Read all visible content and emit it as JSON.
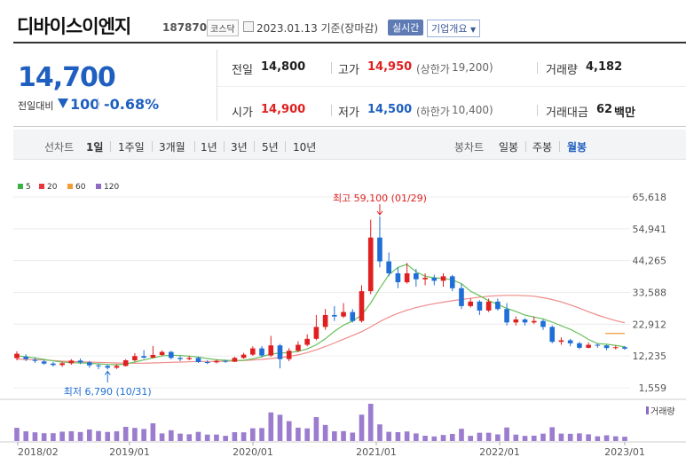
{
  "header": {
    "title": "디바이스이엔지",
    "code": "187870",
    "market_tag": "코스닥",
    "date": "2023.01.13 기준(장마감)",
    "realtime_label": "실시간",
    "company_info_label": "기업개요"
  },
  "quote": {
    "price": "14,700",
    "change_label": "전일대비",
    "change_value": "100",
    "change_pct": "-0.68%",
    "prev_label": "전일",
    "prev_value": "14,800",
    "high_label": "고가",
    "high_value": "14,950",
    "upper_limit_label": "(상한가",
    "upper_limit_value": "19,200)",
    "volume_label": "거래량",
    "volume_value": "4,182",
    "open_label": "시가",
    "open_value": "14,900",
    "low_label": "저가",
    "low_value": "14,500",
    "lower_limit_label": "(하한가",
    "lower_limit_value": "10,400)",
    "amount_label": "거래대금",
    "amount_value": "62",
    "amount_unit": "백만"
  },
  "toolbar": {
    "line_label": "선차트",
    "periods": [
      "1일",
      "1주일",
      "3개월",
      "1년",
      "3년",
      "5년",
      "10년"
    ],
    "candle_label": "봉차트",
    "candle_periods": [
      "일봉",
      "주봉",
      "월봉"
    ],
    "active_candle": "월봉"
  },
  "legend": [
    {
      "name": "5",
      "color": "#3cb043"
    },
    {
      "name": "20",
      "color": "#e8383d"
    },
    {
      "name": "60",
      "color": "#f39c34"
    },
    {
      "name": "120",
      "color": "#8e6cc4"
    }
  ],
  "chart_data": {
    "type": "candlestick",
    "y_ticks": [
      "65,618",
      "54,941",
      "44,265",
      "33,588",
      "22,912",
      "12,235",
      "1,559"
    ],
    "ylim": [
      1559,
      65618
    ],
    "x_ticks": [
      "2018/02",
      "2019/01",
      "2020/01",
      "2021/01",
      "2022/01",
      "2023/01"
    ],
    "high_annotation": "최고 59,100 (01/29)",
    "low_annotation": "최저 6,790 (10/31)",
    "volume_label": "거래량",
    "candles": [
      {
        "o": 11500,
        "c": 13000,
        "h": 13800,
        "l": 10800
      },
      {
        "o": 12000,
        "c": 11200,
        "h": 12800,
        "l": 10500
      },
      {
        "o": 11000,
        "c": 10600,
        "h": 11800,
        "l": 9900
      },
      {
        "o": 10400,
        "c": 9700,
        "h": 10900,
        "l": 9300
      },
      {
        "o": 9700,
        "c": 9200,
        "h": 10200,
        "l": 8700
      },
      {
        "o": 9200,
        "c": 9800,
        "h": 10300,
        "l": 8600
      },
      {
        "o": 9800,
        "c": 10700,
        "h": 11200,
        "l": 9300
      },
      {
        "o": 10700,
        "c": 10100,
        "h": 11400,
        "l": 9500
      },
      {
        "o": 10100,
        "c": 9100,
        "h": 10600,
        "l": 8300
      },
      {
        "o": 9100,
        "c": 8900,
        "h": 9600,
        "l": 7800
      },
      {
        "o": 8900,
        "c": 8300,
        "h": 9300,
        "l": 7700
      },
      {
        "o": 8300,
        "c": 8900,
        "h": 9500,
        "l": 7900
      },
      {
        "o": 8900,
        "c": 10800,
        "h": 11200,
        "l": 8700
      },
      {
        "o": 10800,
        "c": 12200,
        "h": 13200,
        "l": 10400
      },
      {
        "o": 12200,
        "c": 11700,
        "h": 14200,
        "l": 11300
      },
      {
        "o": 11700,
        "c": 12600,
        "h": 15600,
        "l": 11500
      },
      {
        "o": 12600,
        "c": 13600,
        "h": 14100,
        "l": 12200
      },
      {
        "o": 13600,
        "c": 11600,
        "h": 14000,
        "l": 11100
      },
      {
        "o": 11600,
        "c": 11200,
        "h": 12200,
        "l": 10500
      },
      {
        "o": 11200,
        "c": 11600,
        "h": 12300,
        "l": 10800
      },
      {
        "o": 11600,
        "c": 10200,
        "h": 12000,
        "l": 9900
      },
      {
        "o": 10200,
        "c": 10100,
        "h": 10800,
        "l": 9500
      },
      {
        "o": 10100,
        "c": 10600,
        "h": 11100,
        "l": 9800
      },
      {
        "o": 10600,
        "c": 10300,
        "h": 11000,
        "l": 9900
      },
      {
        "o": 10300,
        "c": 11600,
        "h": 12000,
        "l": 10200
      },
      {
        "o": 11600,
        "c": 12700,
        "h": 13300,
        "l": 11300
      },
      {
        "o": 12700,
        "c": 14800,
        "h": 15500,
        "l": 12300
      },
      {
        "o": 14800,
        "c": 12400,
        "h": 15600,
        "l": 11800
      },
      {
        "o": 12400,
        "c": 15800,
        "h": 19000,
        "l": 12000
      },
      {
        "o": 15800,
        "c": 11200,
        "h": 16300,
        "l": 8100
      },
      {
        "o": 11200,
        "c": 14000,
        "h": 14900,
        "l": 10500
      },
      {
        "o": 14000,
        "c": 16000,
        "h": 17200,
        "l": 13500
      },
      {
        "o": 16000,
        "c": 18000,
        "h": 19500,
        "l": 15500
      },
      {
        "o": 18000,
        "c": 22000,
        "h": 26000,
        "l": 17500
      },
      {
        "o": 22000,
        "c": 26000,
        "h": 28000,
        "l": 21000
      },
      {
        "o": 26000,
        "c": 25500,
        "h": 29000,
        "l": 24000
      },
      {
        "o": 25500,
        "c": 27000,
        "h": 30000,
        "l": 25000
      },
      {
        "o": 27000,
        "c": 24000,
        "h": 28000,
        "l": 23500
      },
      {
        "o": 24000,
        "c": 34000,
        "h": 36000,
        "l": 23500
      },
      {
        "o": 34000,
        "c": 52000,
        "h": 58000,
        "l": 33000
      },
      {
        "o": 52000,
        "c": 44000,
        "h": 59100,
        "l": 42000
      },
      {
        "o": 44000,
        "c": 40000,
        "h": 47000,
        "l": 39000
      },
      {
        "o": 40000,
        "c": 37000,
        "h": 42000,
        "l": 35000
      },
      {
        "o": 37000,
        "c": 40000,
        "h": 43500,
        "l": 36500
      },
      {
        "o": 40000,
        "c": 38000,
        "h": 41500,
        "l": 35500
      },
      {
        "o": 38000,
        "c": 38500,
        "h": 40000,
        "l": 36000
      },
      {
        "o": 38500,
        "c": 37500,
        "h": 39500,
        "l": 36000
      },
      {
        "o": 37500,
        "c": 39000,
        "h": 40000,
        "l": 35500
      },
      {
        "o": 39000,
        "c": 35000,
        "h": 39500,
        "l": 34000
      },
      {
        "o": 35000,
        "c": 29000,
        "h": 36500,
        "l": 28000
      },
      {
        "o": 29000,
        "c": 30500,
        "h": 31500,
        "l": 28500
      },
      {
        "o": 30500,
        "c": 27500,
        "h": 31000,
        "l": 26000
      },
      {
        "o": 27500,
        "c": 30500,
        "h": 31500,
        "l": 27000
      },
      {
        "o": 30500,
        "c": 28000,
        "h": 31500,
        "l": 27500
      },
      {
        "o": 28000,
        "c": 23500,
        "h": 30000,
        "l": 22500
      },
      {
        "o": 23500,
        "c": 24500,
        "h": 25500,
        "l": 22500
      },
      {
        "o": 24500,
        "c": 23500,
        "h": 25000,
        "l": 22500
      },
      {
        "o": 23500,
        "c": 24000,
        "h": 25500,
        "l": 23000
      },
      {
        "o": 24000,
        "c": 22000,
        "h": 24500,
        "l": 21000
      },
      {
        "o": 22000,
        "c": 17000,
        "h": 22500,
        "l": 16500
      },
      {
        "o": 17000,
        "c": 17500,
        "h": 18500,
        "l": 16000
      },
      {
        "o": 17500,
        "c": 16500,
        "h": 18000,
        "l": 15500
      },
      {
        "o": 16500,
        "c": 15000,
        "h": 17000,
        "l": 14500
      },
      {
        "o": 15000,
        "c": 16000,
        "h": 16800,
        "l": 14800
      },
      {
        "o": 16000,
        "c": 15800,
        "h": 16500,
        "l": 15000
      },
      {
        "o": 15800,
        "c": 14900,
        "h": 16000,
        "l": 14200
      },
      {
        "o": 14900,
        "c": 15200,
        "h": 15800,
        "l": 14400
      },
      {
        "o": 15200,
        "c": 14700,
        "h": 15600,
        "l": 14300
      }
    ],
    "ma5": [
      12300,
      12000,
      11600,
      11100,
      10600,
      10200,
      10000,
      9900,
      9800,
      9600,
      9400,
      9300,
      9500,
      10200,
      10900,
      11600,
      12300,
      12500,
      12400,
      12200,
      11900,
      11400,
      11000,
      10800,
      10700,
      10800,
      11300,
      12000,
      12900,
      13200,
      13400,
      13800,
      14600,
      16000,
      18000,
      20500,
      22600,
      24000,
      26000,
      30000,
      35000,
      39500,
      42000,
      43000,
      40500,
      39000,
      38500,
      38300,
      37800,
      36500,
      34000,
      32500,
      30800,
      29600,
      28200,
      27200,
      26000,
      25300,
      24700,
      23600,
      22400,
      21200,
      19600,
      17800,
      16400,
      16200,
      15800,
      15300
    ],
    "ma20": [
      11200,
      11100,
      11000,
      10900,
      10700,
      10500,
      10400,
      10300,
      10200,
      10100,
      10000,
      9900,
      9800,
      9800,
      9800,
      9900,
      10000,
      10100,
      10200,
      10300,
      10400,
      10400,
      10400,
      10500,
      10600,
      10700,
      10900,
      11100,
      11400,
      11700,
      12100,
      12600,
      13400,
      14300,
      15400,
      16600,
      17900,
      19100,
      20400,
      22000,
      23800,
      25300,
      26600,
      27600,
      28500,
      29200,
      29800,
      30300,
      30800,
      31200,
      31600,
      32000,
      32300,
      32500,
      32600,
      32600,
      32500,
      32300,
      31800,
      31200,
      30400,
      29400,
      28300,
      27100,
      26000,
      25000,
      24100,
      23400
    ]
  }
}
